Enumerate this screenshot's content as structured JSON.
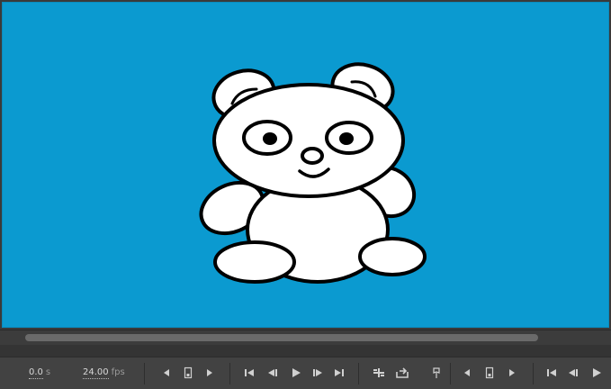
{
  "stage": {
    "background": "#0b9ad0",
    "content": "panda-drawing"
  },
  "timeline": {
    "current_time": "0.0",
    "time_unit": "s",
    "frame_rate": "24.00",
    "frame_rate_unit": "fps"
  },
  "controls": {
    "group1": [
      "step-back-icon",
      "keyframe-icon",
      "step-forward-icon"
    ],
    "group2": [
      "go-to-first-frame-icon",
      "step-back-one-frame-icon",
      "play-icon",
      "step-forward-one-frame-icon",
      "go-to-last-frame-icon"
    ],
    "group3": [
      "insert-frame-icon",
      "loop-icon",
      "marker-icon"
    ],
    "group4": [
      "step-back-icon",
      "keyframe-icon",
      "step-forward-icon"
    ],
    "group5": [
      "go-to-first-frame-icon",
      "step-back-one-frame-icon",
      "play-icon"
    ]
  },
  "colors": {
    "stage_bg": "#0b9ad0",
    "panel_bg": "#424242",
    "icon": "#d0d0d0"
  }
}
